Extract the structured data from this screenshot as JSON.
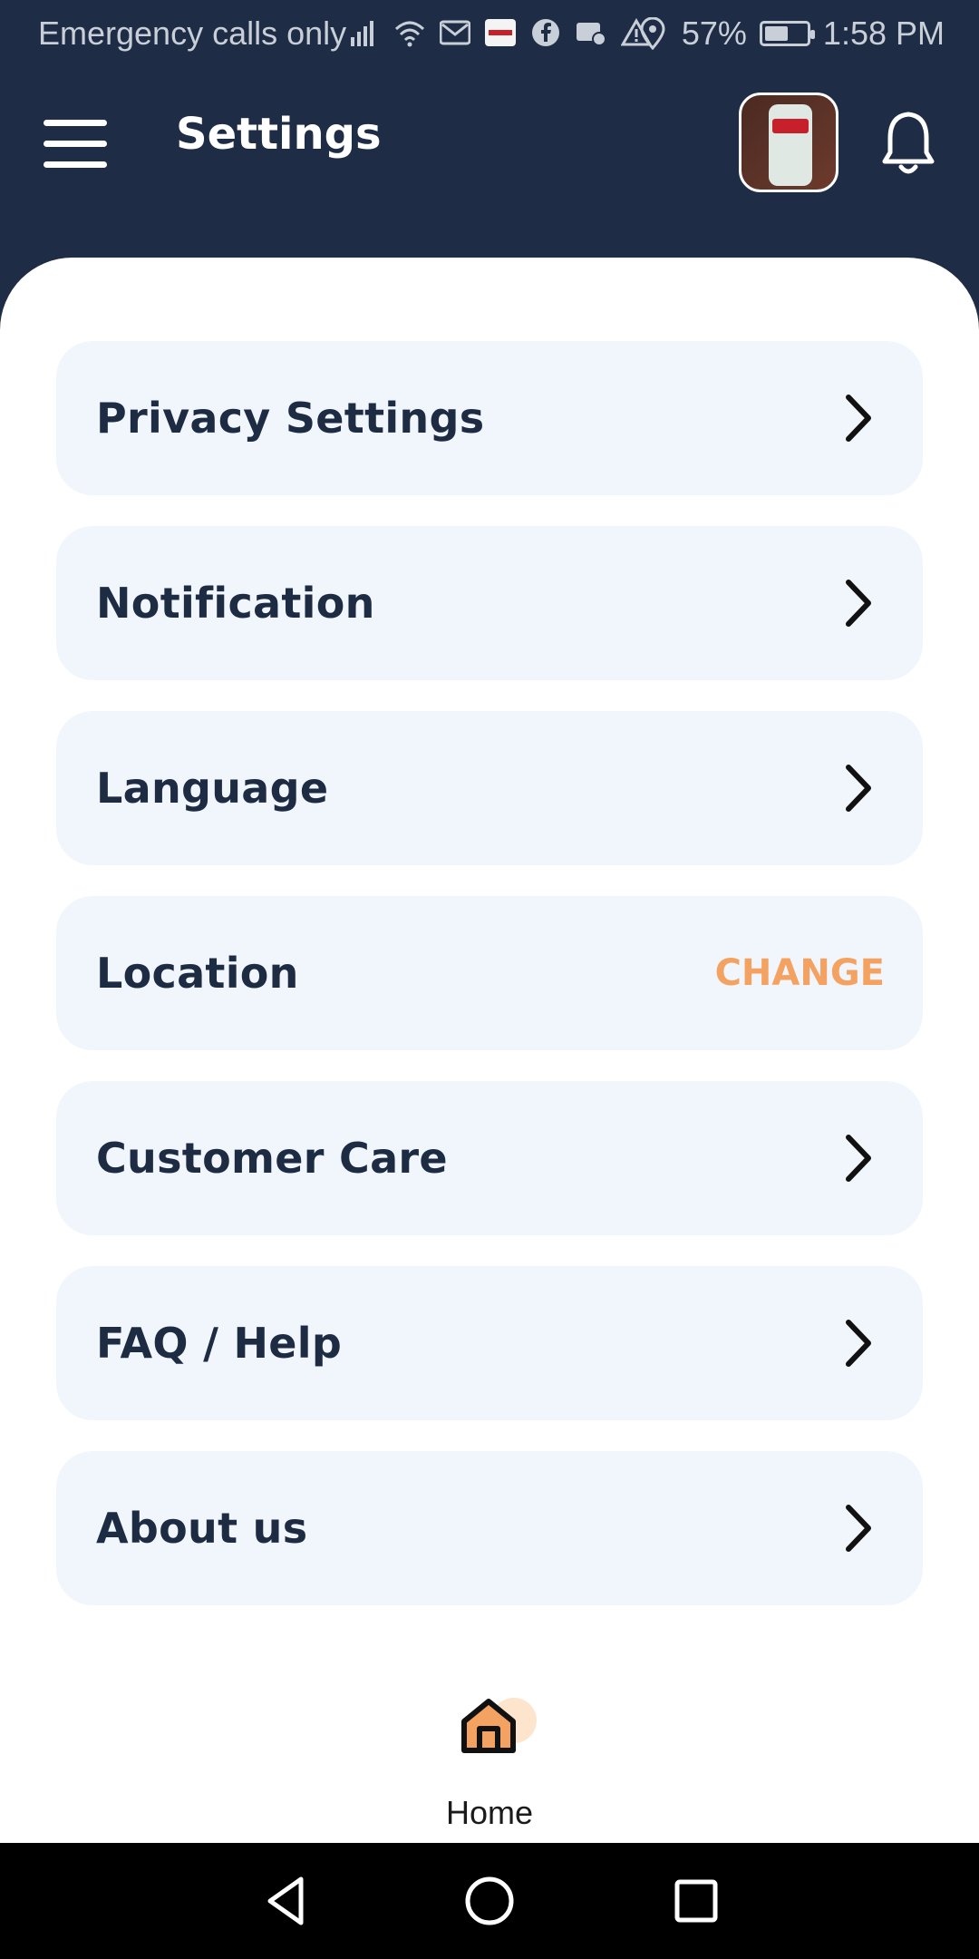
{
  "status_bar": {
    "carrier_text": "Emergency calls only",
    "battery_percent": "57%",
    "battery_level": 0.57,
    "time": "1:58 PM",
    "icons": [
      "signal-icon",
      "wifi-icon",
      "gmail-icon",
      "app-notification-icon",
      "facebook-icon",
      "mail-settings-icon",
      "warning-icon",
      "location-icon",
      "battery-icon"
    ]
  },
  "header": {
    "title": "Settings",
    "menu_icon": "hamburger-menu-icon",
    "notification_icon": "bell-icon"
  },
  "settings_items": [
    {
      "label": "Privacy Settings",
      "action": "chevron-right-icon"
    },
    {
      "label": "Notification",
      "action": "chevron-right-icon"
    },
    {
      "label": "Language",
      "action": "chevron-right-icon"
    },
    {
      "label": "Location",
      "action_text": "CHANGE"
    },
    {
      "label": "Customer Care",
      "action": "chevron-right-icon"
    },
    {
      "label": "FAQ / Help",
      "action": "chevron-right-icon"
    },
    {
      "label": "About us",
      "action": "chevron-right-icon"
    }
  ],
  "bottom_nav": {
    "home_label": "Home",
    "home_icon": "home-icon"
  },
  "colors": {
    "header_bg": "#1e2d45",
    "card_bg": "#f1f6fd",
    "text_dark": "#1d2b43",
    "accent_orange": "#f4a261"
  }
}
